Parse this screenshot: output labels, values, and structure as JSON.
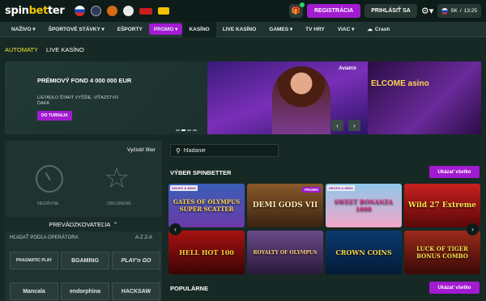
{
  "header": {
    "logo_part1": "spin",
    "logo_part2": "bet",
    "logo_part3": "ter",
    "registration": "REGISTRÁCIA",
    "login": "PRIHLÁSIŤ SA",
    "lang": "SK",
    "time": "13:25"
  },
  "nav": [
    {
      "label": "NAŽIVO ▾"
    },
    {
      "label": "ŠPORTOVÉ STÁVKY ▾"
    },
    {
      "label": "EŠPORTY"
    },
    {
      "label": "PROMO ▾"
    },
    {
      "label": "KASÍNO"
    },
    {
      "label": "LIVE KASÍNO"
    },
    {
      "label": "GAMES ▾"
    },
    {
      "label": "TV HRY"
    },
    {
      "label": "VIAC ▾"
    },
    {
      "label": "Crash"
    }
  ],
  "subtabs": {
    "automaty": "AUTOMATY",
    "live": "LIVE KASÍNO"
  },
  "banner": {
    "title": "PRÉMIOVÝ FOND 4 000 000 EUR",
    "subtitle": "LIETADLO ŠTART VYŠŠIE, VÍŤAZSTVO ĎAKÁ",
    "button": "DO TURNAJA",
    "brand": "Aviatrix",
    "side_text": "ELCOME asino"
  },
  "sidebar": {
    "clear_filter": "Vyčistiť filter",
    "recent": "NEDÁVNE",
    "favorite": "OBĽÚBENÉ",
    "providers_title": "PREVÁDZKOVATEĽIA",
    "search_operator": "HĽADAŤ PODĽA OPERÁTORA",
    "sort": "A-Z Z-A",
    "providers": [
      "PRAGMATIC PLAY",
      "BGAMING",
      "PLAY'n GO",
      "Mancala",
      "endorphina",
      "HACKSAW"
    ]
  },
  "main": {
    "search_placeholder": "hľadanie",
    "section1": "VÝBER SPINBETTER",
    "section2": "POPULÁRNE",
    "show_all": "Ukázať všetko",
    "tag_drops": "DROPS & WINS",
    "tag_promo": "PROMO",
    "games": [
      {
        "name": "GATES OF OLYMPUS SUPER SCATTER",
        "bg": "#3a5fb8"
      },
      {
        "name": "DEMI GODS VII",
        "bg": "#6b4a2a"
      },
      {
        "name": "SWEET BONANZA 1000",
        "bg": "#8ec7ea"
      },
      {
        "name": "Wild 27 Extreme",
        "bg": "#b01818"
      },
      {
        "name": "HELL HOT 100",
        "bg": "#7a0c0c"
      },
      {
        "name": "ROYALTY OF OLYMPUS",
        "bg": "#4a2a6a"
      },
      {
        "name": "CROWN COINS",
        "bg": "#0b3a6e"
      },
      {
        "name": "LUCK OF TIGER BONUS COMBO",
        "bg": "#7a1a14"
      }
    ]
  }
}
